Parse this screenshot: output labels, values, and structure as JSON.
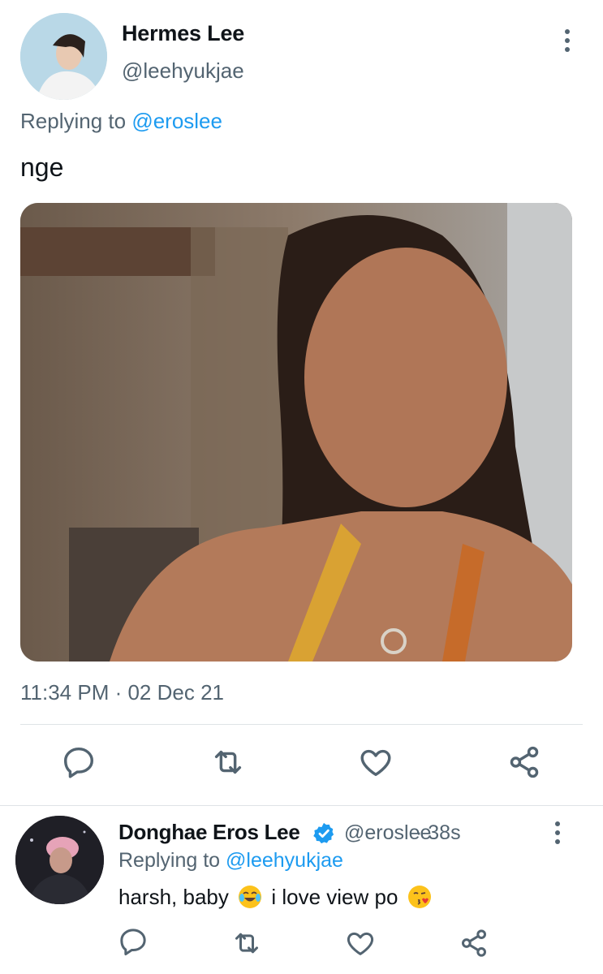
{
  "tweet": {
    "display_name": "Hermes Lee",
    "handle": "@leehyukjae",
    "replying_prefix": "Replying to",
    "replying_to": "@eroslee",
    "text": "nge",
    "timestamp": "11:34 PM · 02 Dec 21"
  },
  "actions": {
    "icons": [
      "reply-icon",
      "retweet-icon",
      "like-icon",
      "share-icon"
    ]
  },
  "reply": {
    "display_name": "Donghae Eros Lee",
    "handle": "@eroslee",
    "time": "· 38s",
    "replying_prefix": "Replying to",
    "replying_to": "@leehyukjae",
    "text_part1": "harsh, baby",
    "text_part2": "i love view po",
    "emoji_1": "face-with-tears-of-joy",
    "emoji_2": "face-blowing-a-kiss"
  },
  "colors": {
    "accent": "#1d9bf0",
    "secondary_text": "#536471",
    "divider": "#dfe3e6"
  }
}
